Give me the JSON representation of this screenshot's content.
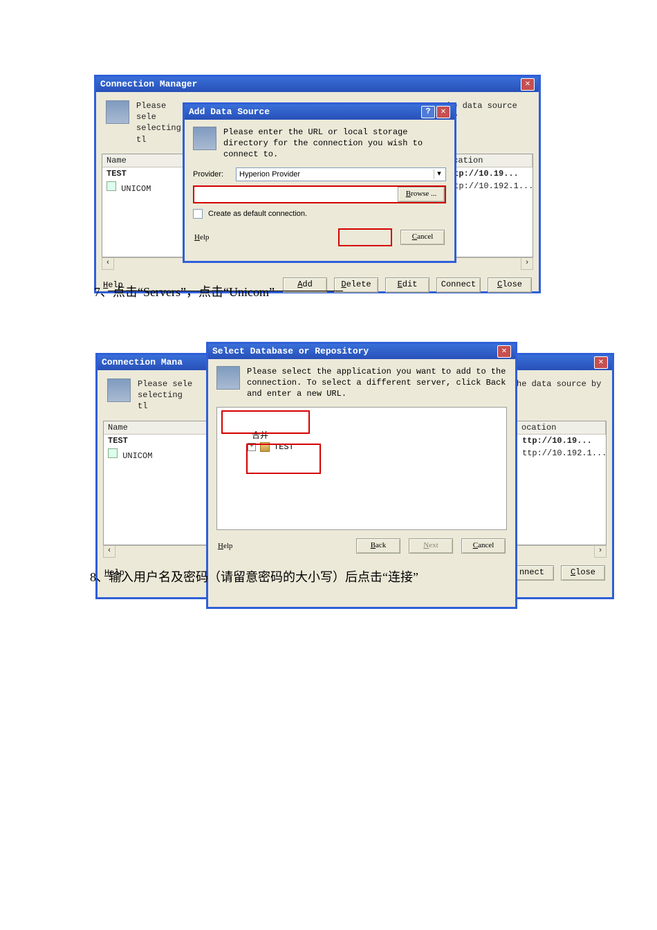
{
  "cm1": {
    "title": "Connection Manager",
    "instruction_prefix": "Please sele",
    "instruction_suffix": "selecting tl",
    "instruction_tail": "he data source by",
    "col_name": "Name",
    "col_loc": "ocation",
    "rows": [
      {
        "name": "TEST",
        "loc": "ttp://10.19..."
      },
      {
        "name": "UNICOM",
        "loc": "ttp://10.192.1..."
      }
    ],
    "btn_help": "Help",
    "btn_add": "Add",
    "btn_delete": "Delete",
    "btn_edit": "Edit",
    "btn_connect": "Connect",
    "btn_close": "Close"
  },
  "ads": {
    "title": "Add Data Source",
    "instruction": "Please enter the URL or local storage directory for the connection you wish to connect to.",
    "provider_label": "Provider:",
    "provider_value": "Hyperion Provider",
    "browse": "Browse ...",
    "create_default": "Create as default connection.",
    "help": "Help",
    "cancel": "Cancel"
  },
  "caption7": {
    "num": "7、",
    "t1": "点击“",
    "w1": "Servers",
    "t2": "”，点击“",
    "w2": "Unicom",
    "t3": "”"
  },
  "cm2": {
    "title": "Connection Mana",
    "instruction_prefix": "Please sele",
    "instruction_suffix": "selecting tl",
    "instruction_tail": "he data source by",
    "col_name": "Name",
    "col_loc": "ocation",
    "rows": [
      {
        "name": "TEST",
        "loc": "ttp://10.19..."
      },
      {
        "name": "UNICOM",
        "loc": "ttp://10.192.1..."
      }
    ],
    "btn_help": "Help",
    "btn_connect": "nnect",
    "btn_close": "Close"
  },
  "sdr": {
    "title": "Select Database or Repository",
    "instruction": "Please select the application you want to add to the connection.  To select a different server, click Back and enter a new URL.",
    "tree_item1_tail": "合并",
    "tree_item2": "TEST",
    "help": "Help",
    "back": "Back",
    "next": "Next",
    "cancel": "Cancel"
  },
  "caption8": {
    "num": "8、",
    "text": "输入用户名及密码（请留意密码的大小写）后点击“连接”"
  }
}
